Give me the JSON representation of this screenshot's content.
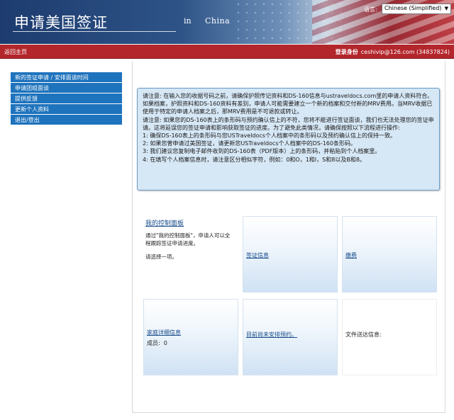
{
  "header": {
    "title": "申请美国签证",
    "subtitle_in": "in",
    "subtitle_country": "China",
    "language_label": "语言:",
    "language_value": "Chinese (Simplified)"
  },
  "navbar": {
    "home_link": "返回主页",
    "login_label": "登录身份",
    "login_user": "ceshivip@126.com (34837824)"
  },
  "sidebar": {
    "items": [
      {
        "label": "新的签证申请 / 安排面谈时间"
      },
      {
        "label": "申请团组面谈"
      },
      {
        "label": "提供反馈"
      },
      {
        "label": "更新个人资料"
      },
      {
        "label": "退出/登出"
      }
    ]
  },
  "notice": {
    "lines": [
      "请注意: 在输入您的收据号码之前，请确保护照传记资料和DS-160信息与ustraveldocs.com里的申请人资料符合。如果档案，护照资料和DS-160资料有差别，申请人可能需要建立一个新的档案和交付新的MRV费用。当MRV收据已使用于特定的申请人档案之后，那MRV费用是不可退款或转让。",
      "请注意: 如果您的DS-160表上的条形码与预约确认信上的不符，您将不能进行签证面谈，我们也无法处理您的签证申请。这将延误您的签证申请和影响获取签证的进度。为了避免此类情况，请确保按照以下流程进行操作:",
      "1: 确保DS-160表上的条形码与您USTraveldocs个人档案中的条形码以及预约确认信上的保持一致。",
      "2: 如果您曾申请过美国签证，请更新您USTraveldocs个人档案中的DS-160条形码。",
      "3: 我们建议您复制电子邮件收到的DS-160表（PDF版本）上的条形码，并粘贴到个人档案里。",
      "4: 在填写个人档案信息时，请注意区分相似字符，例如：0和O，1和I，S和8以及B和8。"
    ]
  },
  "dashboard": {
    "title": "我的控制面板",
    "description": "通过\"我的控制面板\"，申请人可以全程跟踪签证申请进度。",
    "choose": "请选择一项。",
    "tiles": {
      "visa_info": "签证信息",
      "payment": "缴费",
      "family_details": "家庭详细信息",
      "members_label": "成员:",
      "members_count": "0",
      "no_appointment": "目前尚未安排预约。",
      "delivery_info": "文件送达信息:"
    }
  }
}
